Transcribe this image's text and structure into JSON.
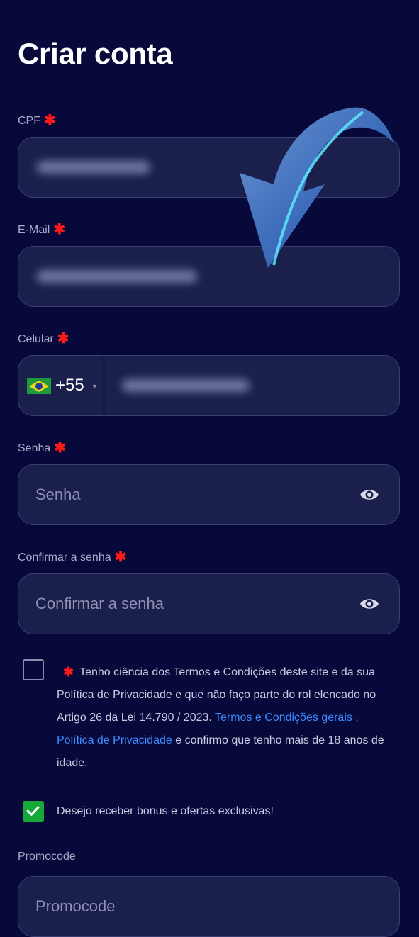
{
  "page_title": "Criar conta",
  "required_mark": "✱",
  "fields": {
    "cpf": {
      "label": "CPF"
    },
    "email": {
      "label": "E-Mail"
    },
    "phone": {
      "label": "Celular",
      "country_code": "+55",
      "country_flag": "brazil-flag-icon"
    },
    "password": {
      "label": "Senha",
      "placeholder": "Senha"
    },
    "confirm_password": {
      "label": "Confirmar a senha",
      "placeholder": "Confirmar a senha"
    },
    "promocode": {
      "label": "Promocode",
      "placeholder": "Promocode"
    }
  },
  "terms": {
    "checked": false,
    "text_before": "Tenho ciência dos Termos e Condições deste site e da sua Política de Privacidade e que não faço parte do rol elencado no Artigo 26 da Lei 14.790 / 2023.",
    "link_terms": "Termos e Condições gerais",
    "separator": ",",
    "link_privacy": "Política de Privacidade",
    "text_after": "e confirmo que tenho mais de 18 anos de idade."
  },
  "bonus_opt_in": {
    "checked": true,
    "label": "Desejo receber bonus e ofertas exclusivas!"
  },
  "colors": {
    "background": "#06093a",
    "field_background": "#1b1f4c",
    "required": "#ff1a1a",
    "link": "#3d8bff",
    "checkbox_checked": "#17a83a"
  }
}
